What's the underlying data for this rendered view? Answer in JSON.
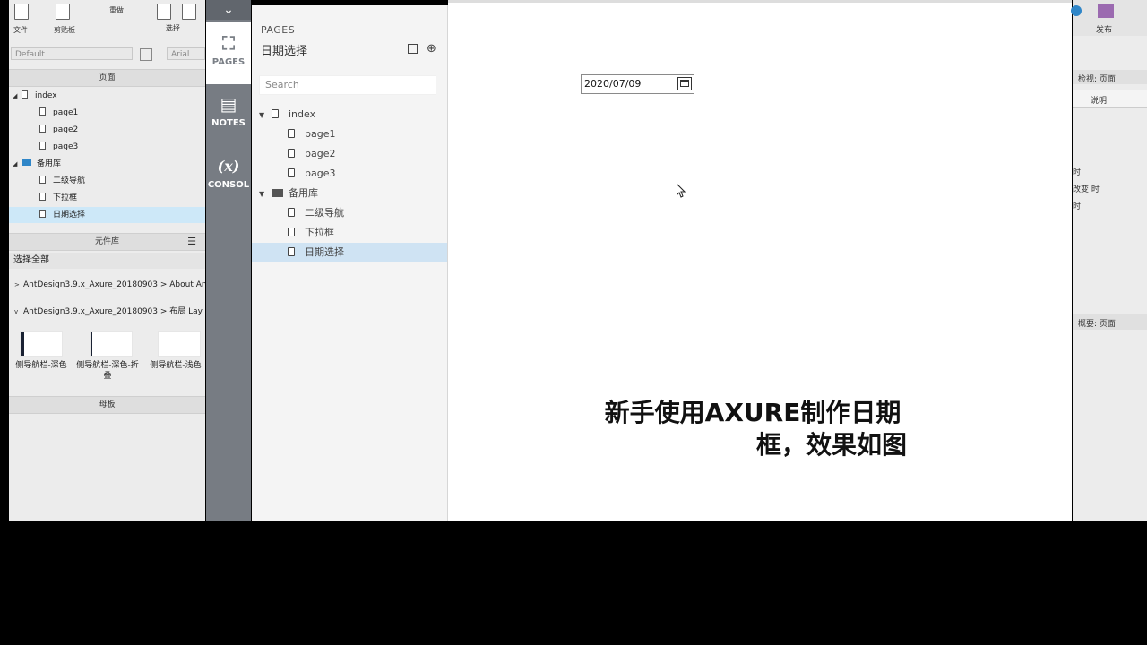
{
  "toolbar": {
    "file": "文件",
    "clipboard": "剪贴板",
    "select": "选择",
    "redo": "重做",
    "style_default": "Default",
    "font": "Arial"
  },
  "sitemap": {
    "header": "页面",
    "items": [
      {
        "label": "index",
        "type": "page",
        "level": 0,
        "expanded": true
      },
      {
        "label": "page1",
        "type": "page",
        "level": 1
      },
      {
        "label": "page2",
        "type": "page",
        "level": 1
      },
      {
        "label": "page3",
        "type": "page",
        "level": 1
      },
      {
        "label": "备用库",
        "type": "folder",
        "level": 0,
        "expanded": true
      },
      {
        "label": "二级导航",
        "type": "page",
        "level": 1
      },
      {
        "label": "下拉框",
        "type": "page",
        "level": 1
      },
      {
        "label": "日期选择",
        "type": "page",
        "level": 1,
        "selected": true
      }
    ]
  },
  "library": {
    "header": "元件库",
    "select_all": "选择全部",
    "groups": [
      {
        "label": "AntDesign3.9.x_Axure_20180903 > About An",
        "expanded": false
      },
      {
        "label": "AntDesign3.9.x_Axure_20180903 > 布局 Lay",
        "expanded": true
      }
    ],
    "widgets": [
      "侧导航栏-深色",
      "侧导航栏-深色-折叠",
      "侧导航栏-浅色"
    ]
  },
  "masters": {
    "header": "母板"
  },
  "nav": {
    "pages": "PAGES",
    "notes": "NOTES",
    "console_icon": "(x)",
    "console": "CONSOL"
  },
  "pages_panel": {
    "title": "PAGES",
    "current": "日期选择",
    "search_placeholder": "Search",
    "items": [
      {
        "label": "index",
        "type": "page",
        "level": 0
      },
      {
        "label": "page1",
        "type": "page",
        "level": 1
      },
      {
        "label": "page2",
        "type": "page",
        "level": 1
      },
      {
        "label": "page3",
        "type": "page",
        "level": 1
      },
      {
        "label": "备用库",
        "type": "folder",
        "level": 0
      },
      {
        "label": "二级导航",
        "type": "page",
        "level": 1
      },
      {
        "label": "下拉框",
        "type": "page",
        "level": 1
      },
      {
        "label": "日期选择",
        "type": "page",
        "level": 1,
        "selected": true
      }
    ]
  },
  "canvas": {
    "date_value": "2020/07/09",
    "caption_line1": "新手使用AXURE制作日期",
    "caption_line2": "框，效果如图"
  },
  "right_panel": {
    "publish": "发布",
    "inspect": "检视: 页面",
    "desc": "说明",
    "t1": "时",
    "t2": "改变 时",
    "t3": "时",
    "summary": "概要: 页面"
  }
}
